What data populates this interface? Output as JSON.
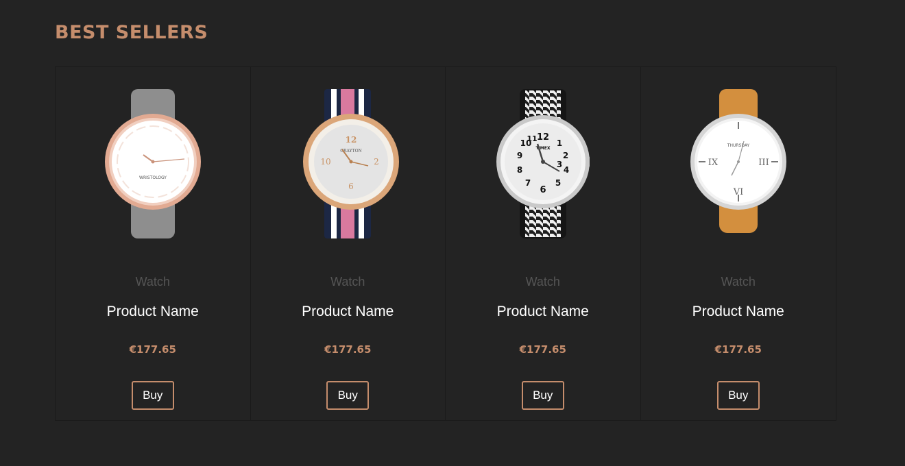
{
  "section": {
    "title": "BEST SELLERS"
  },
  "products": [
    {
      "category": "Watch",
      "name": "Product Name",
      "price": "€177.65",
      "buy_label": "Buy",
      "brand": "WRISTOLOGY",
      "image_icon": "rose-gold-watch-grey-strap",
      "strap_color": "#8e8e8e",
      "case_color": "#e2aa92"
    },
    {
      "category": "Watch",
      "name": "Product Name",
      "price": "€177.65",
      "buy_label": "Buy",
      "brand": "GRAYTON",
      "image_icon": "gold-watch-striped-strap",
      "strap_color": "#1c2744",
      "case_color": "#dba679"
    },
    {
      "category": "Watch",
      "name": "Product Name",
      "price": "€177.65",
      "buy_label": "Buy",
      "brand": "TIMEX",
      "image_icon": "silver-watch-houndstooth-strap",
      "strap_color": "#2a2a2a",
      "case_color": "#c9c9c9"
    },
    {
      "category": "Watch",
      "name": "Product Name",
      "price": "€177.65",
      "buy_label": "Buy",
      "brand": "THURSDAY",
      "image_icon": "silver-watch-tan-strap",
      "strap_color": "#d38f3e",
      "case_color": "#d5d5d5"
    }
  ]
}
